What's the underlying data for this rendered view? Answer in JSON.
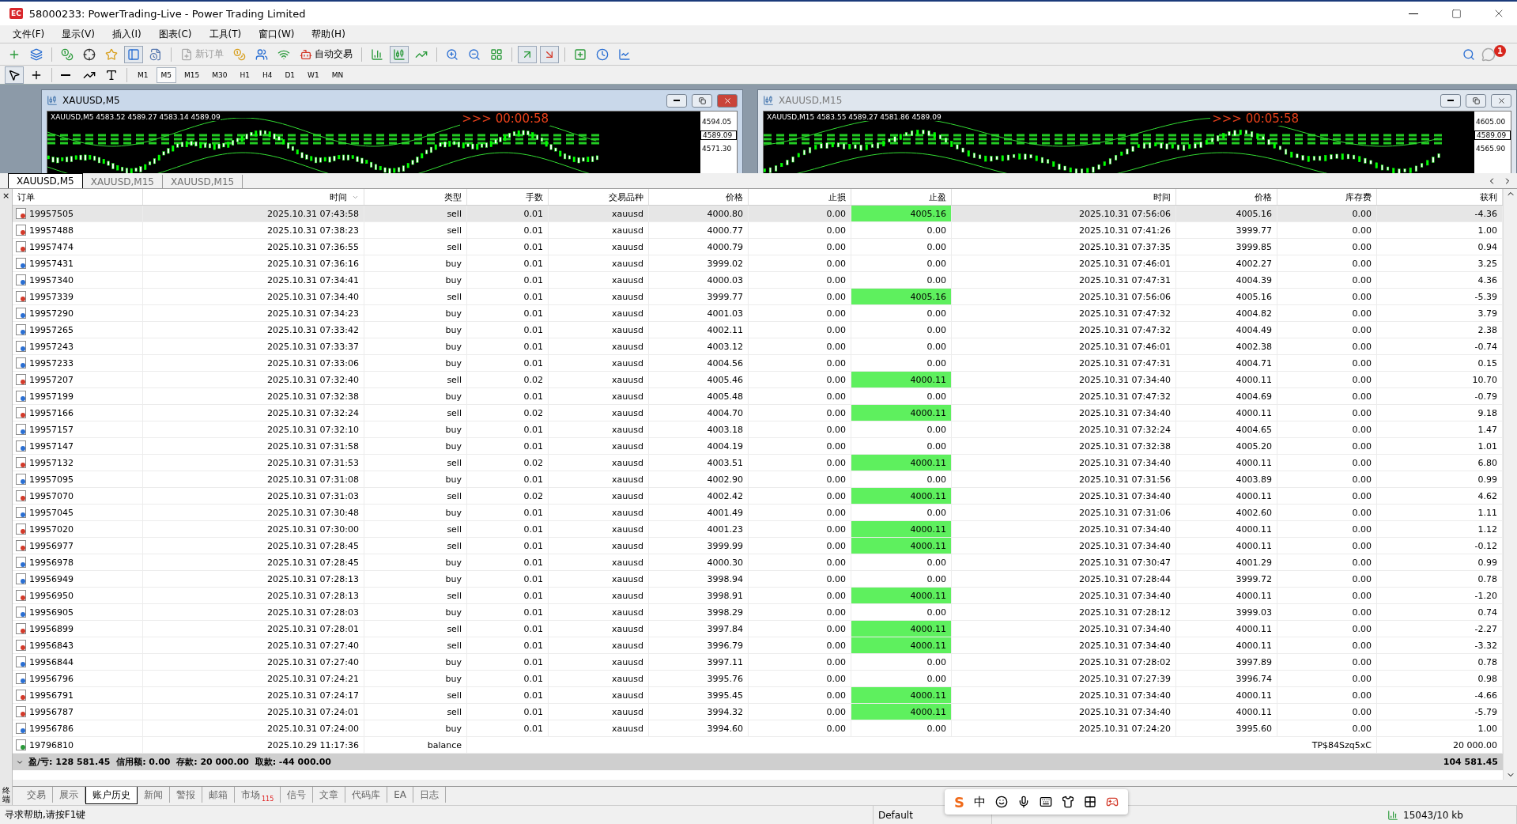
{
  "window": {
    "logo": "EC",
    "title": "58000233: PowerTrading-Live - Power Trading Limited"
  },
  "menu": [
    "文件(F)",
    "显示(V)",
    "插入(I)",
    "图表(C)",
    "工具(T)",
    "窗口(W)",
    "帮助(H)"
  ],
  "toolbar": {
    "new_order": {
      "label": "新订单",
      "disabled": true
    },
    "auto_trading": {
      "label": "自动交易"
    },
    "notification_count": "1"
  },
  "timeframes": [
    {
      "label": "M1",
      "selected": false
    },
    {
      "label": "M5",
      "selected": true
    },
    {
      "label": "M15",
      "selected": false
    },
    {
      "label": "M30",
      "selected": false
    },
    {
      "label": "H1",
      "selected": false
    },
    {
      "label": "H4",
      "selected": false
    },
    {
      "label": "D1",
      "selected": false
    },
    {
      "label": "W1",
      "selected": false
    },
    {
      "label": "MN",
      "selected": false
    }
  ],
  "charts": [
    {
      "title": "XAUUSD,M5",
      "active": true,
      "info": "XAUUSD,M5  4583.52 4589.27 4583.14 4589.09",
      "timer": ">>> 00:00:58",
      "prices": [
        "4594.05",
        "4589.09",
        "4571.30"
      ]
    },
    {
      "title": "XAUUSD,M15",
      "active": false,
      "info": "XAUUSD,M15  4583.55 4589.27 4581.86 4589.09",
      "timer": ">>> 00:05:58",
      "prices": [
        "4605.00",
        "4589.09",
        "4565.90"
      ]
    }
  ],
  "chart_tabs": [
    {
      "label": "XAUUSD,M5",
      "selected": true
    },
    {
      "label": "XAUUSD,M15",
      "selected": false
    },
    {
      "label": "XAUUSD,M15",
      "selected": false
    }
  ],
  "terminal": {
    "close": "×",
    "label": "终端"
  },
  "table": {
    "columns": [
      "订单",
      "时间",
      "类型",
      "手数",
      "交易品种",
      "价格",
      "止损",
      "止盈",
      "时间",
      "价格",
      "库存费",
      "获利"
    ],
    "rows": [
      {
        "kind": "sell",
        "selected": true,
        "tp_hit": true,
        "cells": [
          "19957505",
          "2025.10.31 07:43:58",
          "sell",
          "0.01",
          "xauusd",
          "4000.80",
          "0.00",
          "4005.16",
          "2025.10.31 07:56:06",
          "4005.16",
          "0.00",
          "-4.36"
        ]
      },
      {
        "kind": "sell",
        "selected": false,
        "tp_hit": false,
        "cells": [
          "19957488",
          "2025.10.31 07:38:23",
          "sell",
          "0.01",
          "xauusd",
          "4000.77",
          "0.00",
          "0.00",
          "2025.10.31 07:41:26",
          "3999.77",
          "0.00",
          "1.00"
        ]
      },
      {
        "kind": "sell",
        "selected": false,
        "tp_hit": false,
        "cells": [
          "19957474",
          "2025.10.31 07:36:55",
          "sell",
          "0.01",
          "xauusd",
          "4000.79",
          "0.00",
          "0.00",
          "2025.10.31 07:37:35",
          "3999.85",
          "0.00",
          "0.94"
        ]
      },
      {
        "kind": "buy",
        "selected": false,
        "tp_hit": false,
        "cells": [
          "19957431",
          "2025.10.31 07:36:16",
          "buy",
          "0.01",
          "xauusd",
          "3999.02",
          "0.00",
          "0.00",
          "2025.10.31 07:46:01",
          "4002.27",
          "0.00",
          "3.25"
        ]
      },
      {
        "kind": "buy",
        "selected": false,
        "tp_hit": false,
        "cells": [
          "19957340",
          "2025.10.31 07:34:41",
          "buy",
          "0.01",
          "xauusd",
          "4000.03",
          "0.00",
          "0.00",
          "2025.10.31 07:47:31",
          "4004.39",
          "0.00",
          "4.36"
        ]
      },
      {
        "kind": "sell",
        "selected": false,
        "tp_hit": true,
        "cells": [
          "19957339",
          "2025.10.31 07:34:40",
          "sell",
          "0.01",
          "xauusd",
          "3999.77",
          "0.00",
          "4005.16",
          "2025.10.31 07:56:06",
          "4005.16",
          "0.00",
          "-5.39"
        ]
      },
      {
        "kind": "buy",
        "selected": false,
        "tp_hit": false,
        "cells": [
          "19957290",
          "2025.10.31 07:34:23",
          "buy",
          "0.01",
          "xauusd",
          "4001.03",
          "0.00",
          "0.00",
          "2025.10.31 07:47:32",
          "4004.82",
          "0.00",
          "3.79"
        ]
      },
      {
        "kind": "buy",
        "selected": false,
        "tp_hit": false,
        "cells": [
          "19957265",
          "2025.10.31 07:33:42",
          "buy",
          "0.01",
          "xauusd",
          "4002.11",
          "0.00",
          "0.00",
          "2025.10.31 07:47:32",
          "4004.49",
          "0.00",
          "2.38"
        ]
      },
      {
        "kind": "buy",
        "selected": false,
        "tp_hit": false,
        "cells": [
          "19957243",
          "2025.10.31 07:33:37",
          "buy",
          "0.01",
          "xauusd",
          "4003.12",
          "0.00",
          "0.00",
          "2025.10.31 07:46:01",
          "4002.38",
          "0.00",
          "-0.74"
        ]
      },
      {
        "kind": "buy",
        "selected": false,
        "tp_hit": false,
        "cells": [
          "19957233",
          "2025.10.31 07:33:06",
          "buy",
          "0.01",
          "xauusd",
          "4004.56",
          "0.00",
          "0.00",
          "2025.10.31 07:47:31",
          "4004.71",
          "0.00",
          "0.15"
        ]
      },
      {
        "kind": "sell",
        "selected": false,
        "tp_hit": true,
        "cells": [
          "19957207",
          "2025.10.31 07:32:40",
          "sell",
          "0.02",
          "xauusd",
          "4005.46",
          "0.00",
          "4000.11",
          "2025.10.31 07:34:40",
          "4000.11",
          "0.00",
          "10.70"
        ]
      },
      {
        "kind": "buy",
        "selected": false,
        "tp_hit": false,
        "cells": [
          "19957199",
          "2025.10.31 07:32:38",
          "buy",
          "0.01",
          "xauusd",
          "4005.48",
          "0.00",
          "0.00",
          "2025.10.31 07:47:32",
          "4004.69",
          "0.00",
          "-0.79"
        ]
      },
      {
        "kind": "sell",
        "selected": false,
        "tp_hit": true,
        "cells": [
          "19957166",
          "2025.10.31 07:32:24",
          "sell",
          "0.02",
          "xauusd",
          "4004.70",
          "0.00",
          "4000.11",
          "2025.10.31 07:34:40",
          "4000.11",
          "0.00",
          "9.18"
        ]
      },
      {
        "kind": "buy",
        "selected": false,
        "tp_hit": false,
        "cells": [
          "19957157",
          "2025.10.31 07:32:10",
          "buy",
          "0.01",
          "xauusd",
          "4003.18",
          "0.00",
          "0.00",
          "2025.10.31 07:32:24",
          "4004.65",
          "0.00",
          "1.47"
        ]
      },
      {
        "kind": "buy",
        "selected": false,
        "tp_hit": false,
        "cells": [
          "19957147",
          "2025.10.31 07:31:58",
          "buy",
          "0.01",
          "xauusd",
          "4004.19",
          "0.00",
          "0.00",
          "2025.10.31 07:32:38",
          "4005.20",
          "0.00",
          "1.01"
        ]
      },
      {
        "kind": "sell",
        "selected": false,
        "tp_hit": true,
        "cells": [
          "19957132",
          "2025.10.31 07:31:53",
          "sell",
          "0.02",
          "xauusd",
          "4003.51",
          "0.00",
          "4000.11",
          "2025.10.31 07:34:40",
          "4000.11",
          "0.00",
          "6.80"
        ]
      },
      {
        "kind": "buy",
        "selected": false,
        "tp_hit": false,
        "cells": [
          "19957095",
          "2025.10.31 07:31:08",
          "buy",
          "0.01",
          "xauusd",
          "4002.90",
          "0.00",
          "0.00",
          "2025.10.31 07:31:56",
          "4003.89",
          "0.00",
          "0.99"
        ]
      },
      {
        "kind": "sell",
        "selected": false,
        "tp_hit": true,
        "cells": [
          "19957070",
          "2025.10.31 07:31:03",
          "sell",
          "0.02",
          "xauusd",
          "4002.42",
          "0.00",
          "4000.11",
          "2025.10.31 07:34:40",
          "4000.11",
          "0.00",
          "4.62"
        ]
      },
      {
        "kind": "buy",
        "selected": false,
        "tp_hit": false,
        "cells": [
          "19957045",
          "2025.10.31 07:30:48",
          "buy",
          "0.01",
          "xauusd",
          "4001.49",
          "0.00",
          "0.00",
          "2025.10.31 07:31:06",
          "4002.60",
          "0.00",
          "1.11"
        ]
      },
      {
        "kind": "sell",
        "selected": false,
        "tp_hit": true,
        "cells": [
          "19957020",
          "2025.10.31 07:30:00",
          "sell",
          "0.01",
          "xauusd",
          "4001.23",
          "0.00",
          "4000.11",
          "2025.10.31 07:34:40",
          "4000.11",
          "0.00",
          "1.12"
        ]
      },
      {
        "kind": "sell",
        "selected": false,
        "tp_hit": true,
        "cells": [
          "19956977",
          "2025.10.31 07:28:45",
          "sell",
          "0.01",
          "xauusd",
          "3999.99",
          "0.00",
          "4000.11",
          "2025.10.31 07:34:40",
          "4000.11",
          "0.00",
          "-0.12"
        ]
      },
      {
        "kind": "buy",
        "selected": false,
        "tp_hit": false,
        "cells": [
          "19956978",
          "2025.10.31 07:28:45",
          "buy",
          "0.01",
          "xauusd",
          "4000.30",
          "0.00",
          "0.00",
          "2025.10.31 07:30:47",
          "4001.29",
          "0.00",
          "0.99"
        ]
      },
      {
        "kind": "buy",
        "selected": false,
        "tp_hit": false,
        "cells": [
          "19956949",
          "2025.10.31 07:28:13",
          "buy",
          "0.01",
          "xauusd",
          "3998.94",
          "0.00",
          "0.00",
          "2025.10.31 07:28:44",
          "3999.72",
          "0.00",
          "0.78"
        ]
      },
      {
        "kind": "sell",
        "selected": false,
        "tp_hit": true,
        "cells": [
          "19956950",
          "2025.10.31 07:28:13",
          "sell",
          "0.01",
          "xauusd",
          "3998.91",
          "0.00",
          "4000.11",
          "2025.10.31 07:34:40",
          "4000.11",
          "0.00",
          "-1.20"
        ]
      },
      {
        "kind": "buy",
        "selected": false,
        "tp_hit": false,
        "cells": [
          "19956905",
          "2025.10.31 07:28:03",
          "buy",
          "0.01",
          "xauusd",
          "3998.29",
          "0.00",
          "0.00",
          "2025.10.31 07:28:12",
          "3999.03",
          "0.00",
          "0.74"
        ]
      },
      {
        "kind": "sell",
        "selected": false,
        "tp_hit": true,
        "cells": [
          "19956899",
          "2025.10.31 07:28:01",
          "sell",
          "0.01",
          "xauusd",
          "3997.84",
          "0.00",
          "4000.11",
          "2025.10.31 07:34:40",
          "4000.11",
          "0.00",
          "-2.27"
        ]
      },
      {
        "kind": "sell",
        "selected": false,
        "tp_hit": true,
        "cells": [
          "19956843",
          "2025.10.31 07:27:40",
          "sell",
          "0.01",
          "xauusd",
          "3996.79",
          "0.00",
          "4000.11",
          "2025.10.31 07:34:40",
          "4000.11",
          "0.00",
          "-3.32"
        ]
      },
      {
        "kind": "buy",
        "selected": false,
        "tp_hit": false,
        "cells": [
          "19956844",
          "2025.10.31 07:27:40",
          "buy",
          "0.01",
          "xauusd",
          "3997.11",
          "0.00",
          "0.00",
          "2025.10.31 07:28:02",
          "3997.89",
          "0.00",
          "0.78"
        ]
      },
      {
        "kind": "buy",
        "selected": false,
        "tp_hit": false,
        "cells": [
          "19956796",
          "2025.10.31 07:24:21",
          "buy",
          "0.01",
          "xauusd",
          "3995.76",
          "0.00",
          "0.00",
          "2025.10.31 07:27:39",
          "3996.74",
          "0.00",
          "0.98"
        ]
      },
      {
        "kind": "sell",
        "selected": false,
        "tp_hit": true,
        "cells": [
          "19956791",
          "2025.10.31 07:24:17",
          "sell",
          "0.01",
          "xauusd",
          "3995.45",
          "0.00",
          "4000.11",
          "2025.10.31 07:34:40",
          "4000.11",
          "0.00",
          "-4.66"
        ]
      },
      {
        "kind": "sell",
        "selected": false,
        "tp_hit": true,
        "cells": [
          "19956787",
          "2025.10.31 07:24:01",
          "sell",
          "0.01",
          "xauusd",
          "3994.32",
          "0.00",
          "4000.11",
          "2025.10.31 07:34:40",
          "4000.11",
          "0.00",
          "-5.79"
        ]
      },
      {
        "kind": "buy",
        "selected": false,
        "tp_hit": false,
        "cells": [
          "19956786",
          "2025.10.31 07:24:00",
          "buy",
          "0.01",
          "xauusd",
          "3994.60",
          "0.00",
          "0.00",
          "2025.10.31 07:24:20",
          "3995.60",
          "0.00",
          "1.00"
        ]
      }
    ],
    "balance_row": {
      "order": "19796810",
      "time": "2025.10.29 11:17:36",
      "type": "balance",
      "comment": "TP$84Szq5xC",
      "amount": "20 000.00"
    },
    "summary": {
      "text": "盈/亏: 128 581.45  信用额: 0.00  存款: 20 000.00  取款: -44 000.00",
      "total": "104 581.45"
    }
  },
  "bottom_tabs": [
    {
      "label": "交易",
      "selected": false
    },
    {
      "label": "展示",
      "selected": false
    },
    {
      "label": "账户历史",
      "selected": true
    },
    {
      "label": "新闻",
      "selected": false
    },
    {
      "label": "警报",
      "selected": false
    },
    {
      "label": "邮箱",
      "selected": false
    },
    {
      "label": "市场",
      "badge": "115",
      "selected": false
    },
    {
      "label": "信号",
      "selected": false
    },
    {
      "label": "文章",
      "selected": false
    },
    {
      "label": "代码库",
      "selected": false
    },
    {
      "label": "EA",
      "selected": false
    },
    {
      "label": "日志",
      "selected": false
    }
  ],
  "ime": {
    "logo": "S",
    "mode": "中"
  },
  "status_bar": {
    "help": "寻求帮助,请按F1键",
    "profile": "Default",
    "traffic": "15043/10 kb"
  }
}
